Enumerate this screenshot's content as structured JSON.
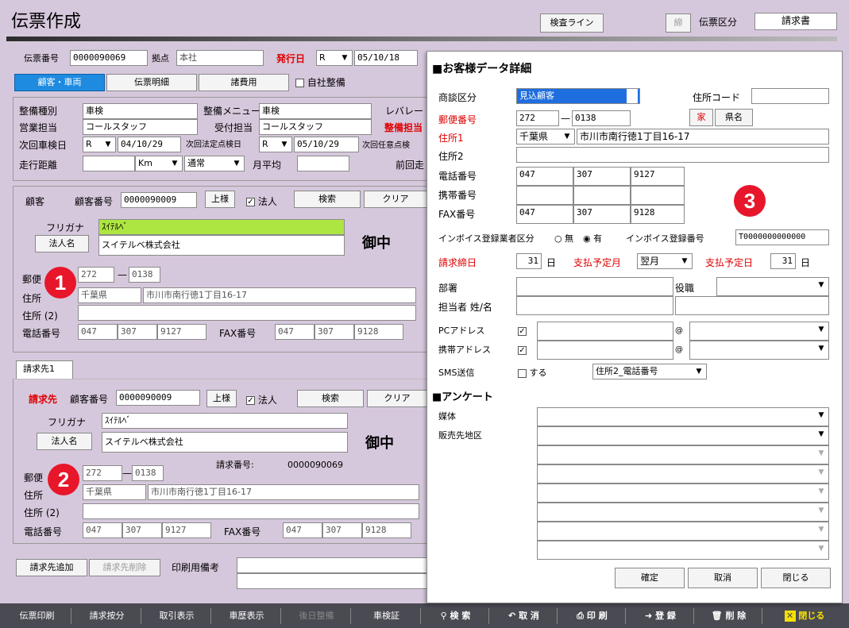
{
  "window": {
    "title": "伝票作成"
  },
  "header": {
    "inspection_line_btn": "検査ライン",
    "lock_btn": "締",
    "slip_type_label": "伝票区分",
    "slip_type_value": "請求書"
  },
  "form": {
    "slip_no_label": "伝票番号",
    "slip_no": "0000090069",
    "base_label": "拠点",
    "base_value": "本社",
    "issue_date_label": "発行日",
    "issue_era": "R",
    "issue_date": "05/10/18"
  },
  "tabs": [
    {
      "label": "顧客・車両"
    },
    {
      "label": "伝票明細"
    },
    {
      "label": "諸費用"
    }
  ],
  "own_maintenance": "自社整備",
  "vehicle": {
    "type_label": "整備種別",
    "type_value": "車検",
    "menu_label": "整備メニュー",
    "menu_value": "車検",
    "level_label": "レバレート",
    "sales_label": "営業担当",
    "sales_value": "コールスタッフ",
    "recv_label": "受付担当",
    "recv_value": "コールスタッフ",
    "maint_staff_label": "整備担当",
    "next_inspection_label": "次回車検日",
    "next_inspection_era": "R",
    "next_inspection_date": "04/10/29",
    "next_legal_label": "次回法定点検日",
    "next_legal_era": "R",
    "next_legal_date": "05/10/29",
    "next_optional_label": "次回任意点検",
    "mileage_label": "走行距離",
    "mileage_unit": "Km",
    "mileage_mode": "通常",
    "monthly_avg_label": "月平均",
    "prev_label": "前回走"
  },
  "customer": {
    "label": "顧客",
    "no_label": "顧客番号",
    "no": "0000090009",
    "upper_btn": "上様",
    "corp_label": "法人",
    "search_btn": "検索",
    "clear_btn": "クリア",
    "furigana_label": "フリガナ",
    "furigana": "ｽｲﾃﾙﾍﾞ",
    "corp_name_btn": "法人名",
    "name": "スイテルベ株式会社",
    "honorific": "御中",
    "postal_label": "郵便",
    "postal1": "272",
    "postal2": "0138",
    "address_label": "住所",
    "pref": "千葉県",
    "address": "市川市南行徳1丁目16-17",
    "address2_label": "住所 (2)",
    "phone_label": "電話番号",
    "phone": [
      "047",
      "307",
      "9127"
    ],
    "fax_label": "FAX番号",
    "fax": [
      "047",
      "307",
      "9128"
    ]
  },
  "billing": {
    "tab_label": "請求先1",
    "label": "請求先",
    "no_label": "顧客番号",
    "no": "0000090009",
    "upper_btn": "上様",
    "corp_label": "法人",
    "search_btn": "検索",
    "clear_btn": "クリア",
    "furigana_label": "フリガナ",
    "furigana": "ｽｲﾃﾙﾍﾞ",
    "corp_name_btn": "法人名",
    "name": "スイテルベ株式会社",
    "honorific": "御中",
    "invoice_no_label": "請求番号:",
    "invoice_no": "0000090069",
    "postal_label": "郵便",
    "postal1": "272",
    "postal2": "0138",
    "address_label": "住所",
    "pref": "千葉県",
    "address": "市川市南行徳1丁目16-17",
    "address2_label": "住所 (2)",
    "phone_label": "電話番号",
    "phone": [
      "047",
      "307",
      "9127"
    ],
    "fax_label": "FAX番号",
    "fax": [
      "047",
      "307",
      "9128"
    ]
  },
  "bottom": {
    "add_billing_btn": "請求先追加",
    "del_billing_btn": "請求先削除",
    "print_note_label": "印刷用備考"
  },
  "toolbar": [
    "伝票印刷",
    "請求按分",
    "取引表示",
    "車歴表示",
    "後日整備",
    "車検証",
    "検 索",
    "取 消",
    "印 刷",
    "登 録",
    "削 除",
    "閉じる"
  ],
  "badges": [
    "1",
    "2",
    "3"
  ],
  "detail": {
    "title": "■お客様データ詳細",
    "deal_label": "商談区分",
    "deal_value": "見込顧客",
    "addr_code_label": "住所コード",
    "postal_label": "郵便番号",
    "postal1": "272",
    "postal2": "0138",
    "home_btn": "家",
    "pref_btn": "県名",
    "addr1_label": "住所1",
    "pref": "千葉県",
    "addr1": "市川市南行徳1丁目16-17",
    "addr2_label": "住所2",
    "phone_label": "電話番号",
    "phone": [
      "047",
      "307",
      "9127"
    ],
    "mobile_label": "携帯番号",
    "fax_label": "FAX番号",
    "fax": [
      "047",
      "307",
      "9128"
    ],
    "invoice_type_label": "インボイス登録業者区分",
    "radio_no": "無",
    "radio_yes": "有",
    "invoice_reg_label": "インボイス登録番号",
    "invoice_reg_value": "T0000000000000",
    "closing_label": "請求締日",
    "closing_day": "31",
    "day_unit": "日",
    "pay_month_label": "支払予定月",
    "pay_month": "翌月",
    "pay_day_label": "支払予定日",
    "pay_day": "31",
    "dept_label": "部署",
    "title_label": "役職",
    "contact_label": "担当者 姓/名",
    "pc_addr_label": "PCアドレス",
    "mobile_addr_label": "携帯アドレス",
    "at": "@",
    "sms_label": "SMS送信",
    "sms_check": "する",
    "sms_target": "住所2_電話番号",
    "survey_title": "■アンケート",
    "media_label": "媒体",
    "sales_area_label": "販売先地区",
    "confirm_btn": "確定",
    "cancel_btn": "取消",
    "close_btn": "閉じる"
  }
}
